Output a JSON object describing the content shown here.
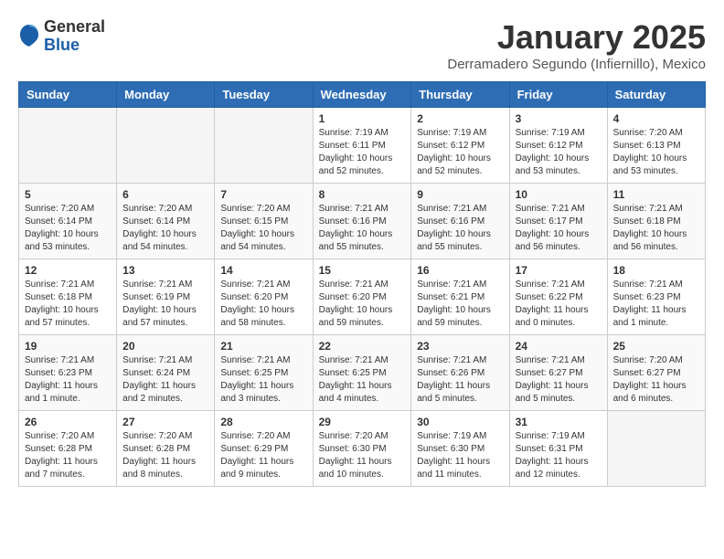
{
  "header": {
    "logo_general": "General",
    "logo_blue": "Blue",
    "month_title": "January 2025",
    "location": "Derramadero Segundo (Infiernillo), Mexico"
  },
  "weekdays": [
    "Sunday",
    "Monday",
    "Tuesday",
    "Wednesday",
    "Thursday",
    "Friday",
    "Saturday"
  ],
  "weeks": [
    [
      {
        "day": "",
        "info": ""
      },
      {
        "day": "",
        "info": ""
      },
      {
        "day": "",
        "info": ""
      },
      {
        "day": "1",
        "info": "Sunrise: 7:19 AM\nSunset: 6:11 PM\nDaylight: 10 hours\nand 52 minutes."
      },
      {
        "day": "2",
        "info": "Sunrise: 7:19 AM\nSunset: 6:12 PM\nDaylight: 10 hours\nand 52 minutes."
      },
      {
        "day": "3",
        "info": "Sunrise: 7:19 AM\nSunset: 6:12 PM\nDaylight: 10 hours\nand 53 minutes."
      },
      {
        "day": "4",
        "info": "Sunrise: 7:20 AM\nSunset: 6:13 PM\nDaylight: 10 hours\nand 53 minutes."
      }
    ],
    [
      {
        "day": "5",
        "info": "Sunrise: 7:20 AM\nSunset: 6:14 PM\nDaylight: 10 hours\nand 53 minutes."
      },
      {
        "day": "6",
        "info": "Sunrise: 7:20 AM\nSunset: 6:14 PM\nDaylight: 10 hours\nand 54 minutes."
      },
      {
        "day": "7",
        "info": "Sunrise: 7:20 AM\nSunset: 6:15 PM\nDaylight: 10 hours\nand 54 minutes."
      },
      {
        "day": "8",
        "info": "Sunrise: 7:21 AM\nSunset: 6:16 PM\nDaylight: 10 hours\nand 55 minutes."
      },
      {
        "day": "9",
        "info": "Sunrise: 7:21 AM\nSunset: 6:16 PM\nDaylight: 10 hours\nand 55 minutes."
      },
      {
        "day": "10",
        "info": "Sunrise: 7:21 AM\nSunset: 6:17 PM\nDaylight: 10 hours\nand 56 minutes."
      },
      {
        "day": "11",
        "info": "Sunrise: 7:21 AM\nSunset: 6:18 PM\nDaylight: 10 hours\nand 56 minutes."
      }
    ],
    [
      {
        "day": "12",
        "info": "Sunrise: 7:21 AM\nSunset: 6:18 PM\nDaylight: 10 hours\nand 57 minutes."
      },
      {
        "day": "13",
        "info": "Sunrise: 7:21 AM\nSunset: 6:19 PM\nDaylight: 10 hours\nand 57 minutes."
      },
      {
        "day": "14",
        "info": "Sunrise: 7:21 AM\nSunset: 6:20 PM\nDaylight: 10 hours\nand 58 minutes."
      },
      {
        "day": "15",
        "info": "Sunrise: 7:21 AM\nSunset: 6:20 PM\nDaylight: 10 hours\nand 59 minutes."
      },
      {
        "day": "16",
        "info": "Sunrise: 7:21 AM\nSunset: 6:21 PM\nDaylight: 10 hours\nand 59 minutes."
      },
      {
        "day": "17",
        "info": "Sunrise: 7:21 AM\nSunset: 6:22 PM\nDaylight: 11 hours\nand 0 minutes."
      },
      {
        "day": "18",
        "info": "Sunrise: 7:21 AM\nSunset: 6:23 PM\nDaylight: 11 hours\nand 1 minute."
      }
    ],
    [
      {
        "day": "19",
        "info": "Sunrise: 7:21 AM\nSunset: 6:23 PM\nDaylight: 11 hours\nand 1 minute."
      },
      {
        "day": "20",
        "info": "Sunrise: 7:21 AM\nSunset: 6:24 PM\nDaylight: 11 hours\nand 2 minutes."
      },
      {
        "day": "21",
        "info": "Sunrise: 7:21 AM\nSunset: 6:25 PM\nDaylight: 11 hours\nand 3 minutes."
      },
      {
        "day": "22",
        "info": "Sunrise: 7:21 AM\nSunset: 6:25 PM\nDaylight: 11 hours\nand 4 minutes."
      },
      {
        "day": "23",
        "info": "Sunrise: 7:21 AM\nSunset: 6:26 PM\nDaylight: 11 hours\nand 5 minutes."
      },
      {
        "day": "24",
        "info": "Sunrise: 7:21 AM\nSunset: 6:27 PM\nDaylight: 11 hours\nand 5 minutes."
      },
      {
        "day": "25",
        "info": "Sunrise: 7:20 AM\nSunset: 6:27 PM\nDaylight: 11 hours\nand 6 minutes."
      }
    ],
    [
      {
        "day": "26",
        "info": "Sunrise: 7:20 AM\nSunset: 6:28 PM\nDaylight: 11 hours\nand 7 minutes."
      },
      {
        "day": "27",
        "info": "Sunrise: 7:20 AM\nSunset: 6:28 PM\nDaylight: 11 hours\nand 8 minutes."
      },
      {
        "day": "28",
        "info": "Sunrise: 7:20 AM\nSunset: 6:29 PM\nDaylight: 11 hours\nand 9 minutes."
      },
      {
        "day": "29",
        "info": "Sunrise: 7:20 AM\nSunset: 6:30 PM\nDaylight: 11 hours\nand 10 minutes."
      },
      {
        "day": "30",
        "info": "Sunrise: 7:19 AM\nSunset: 6:30 PM\nDaylight: 11 hours\nand 11 minutes."
      },
      {
        "day": "31",
        "info": "Sunrise: 7:19 AM\nSunset: 6:31 PM\nDaylight: 11 hours\nand 12 minutes."
      },
      {
        "day": "",
        "info": ""
      }
    ]
  ]
}
